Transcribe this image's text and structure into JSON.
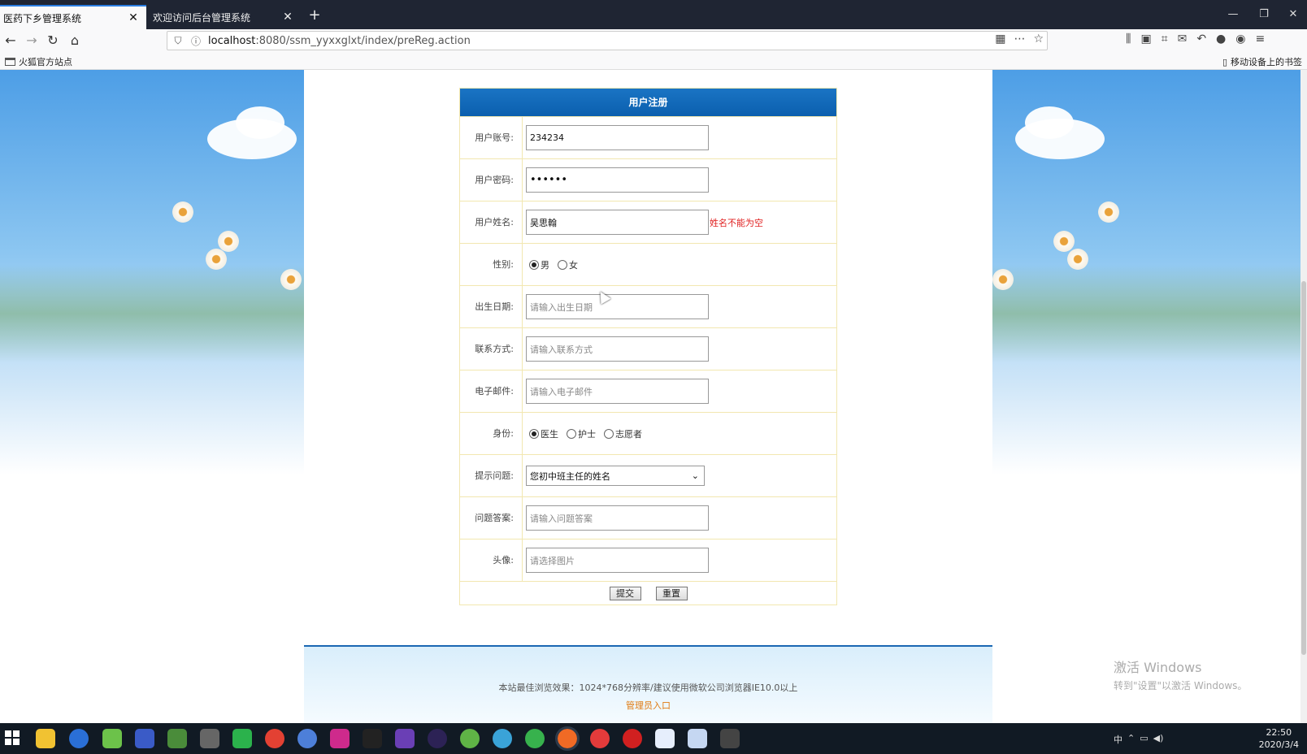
{
  "browser": {
    "tabs": [
      {
        "title": "医药下乡管理系统",
        "active": true
      },
      {
        "title": "欢迎访问后台管理系统",
        "active": false
      }
    ],
    "url_host": "localhost",
    "url_path": ":8080/ssm_yyxxglxt/index/preReg.action",
    "bookmark_left": "火狐官方站点",
    "bookmark_right": "移动设备上的书签"
  },
  "form": {
    "title": "用户注册",
    "fields": {
      "account": {
        "label": "用户账号:",
        "value": "234234"
      },
      "password": {
        "label": "用户密码:",
        "value": "••••••"
      },
      "name": {
        "label": "用户姓名:",
        "value": "吴思翰",
        "error": "姓名不能为空"
      },
      "gender": {
        "label": "性别:",
        "options": [
          "男",
          "女"
        ],
        "selected": "男"
      },
      "birthday": {
        "label": "出生日期:",
        "placeholder": "请输入出生日期"
      },
      "phone": {
        "label": "联系方式:",
        "placeholder": "请输入联系方式"
      },
      "email": {
        "label": "电子邮件:",
        "placeholder": "请输入电子邮件"
      },
      "role": {
        "label": "身份:",
        "options": [
          "医生",
          "护士",
          "志愿者"
        ],
        "selected": "医生"
      },
      "question": {
        "label": "提示问题:",
        "value": "您初中班主任的姓名"
      },
      "answer": {
        "label": "问题答案:",
        "placeholder": "请输入问题答案"
      },
      "avatar": {
        "label": "头像:",
        "placeholder": "请选择图片"
      }
    },
    "submit_label": "提交",
    "reset_label": "重置"
  },
  "footer": {
    "notice": "本站最佳浏览效果：1024*768分辨率/建议使用微软公司浏览器IE10.0以上",
    "admin_link": "管理员入口"
  },
  "watermark": {
    "line1": "激活 Windows",
    "line2": "转到\"设置\"以激活 Windows。"
  },
  "taskbar": {
    "time": "22:50",
    "date": "2020/3/4",
    "ime": "中"
  }
}
